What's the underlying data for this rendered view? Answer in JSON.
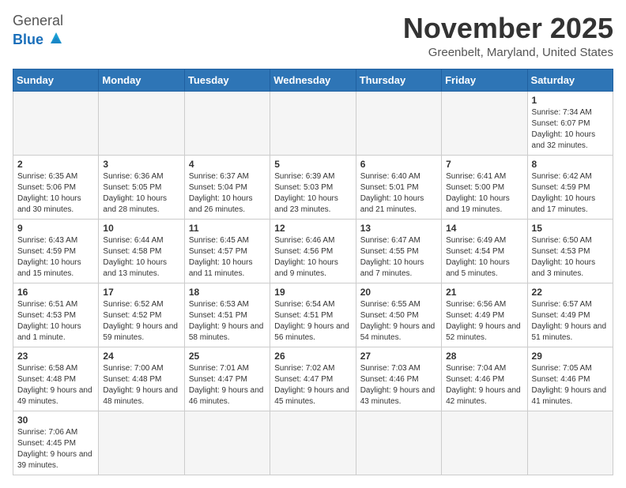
{
  "header": {
    "logo_general": "General",
    "logo_blue": "Blue",
    "month_title": "November 2025",
    "location": "Greenbelt, Maryland, United States"
  },
  "weekdays": [
    "Sunday",
    "Monday",
    "Tuesday",
    "Wednesday",
    "Thursday",
    "Friday",
    "Saturday"
  ],
  "weeks": [
    [
      {
        "day": "",
        "info": ""
      },
      {
        "day": "",
        "info": ""
      },
      {
        "day": "",
        "info": ""
      },
      {
        "day": "",
        "info": ""
      },
      {
        "day": "",
        "info": ""
      },
      {
        "day": "",
        "info": ""
      },
      {
        "day": "1",
        "info": "Sunrise: 7:34 AM\nSunset: 6:07 PM\nDaylight: 10 hours and 32 minutes."
      }
    ],
    [
      {
        "day": "2",
        "info": "Sunrise: 6:35 AM\nSunset: 5:06 PM\nDaylight: 10 hours and 30 minutes."
      },
      {
        "day": "3",
        "info": "Sunrise: 6:36 AM\nSunset: 5:05 PM\nDaylight: 10 hours and 28 minutes."
      },
      {
        "day": "4",
        "info": "Sunrise: 6:37 AM\nSunset: 5:04 PM\nDaylight: 10 hours and 26 minutes."
      },
      {
        "day": "5",
        "info": "Sunrise: 6:39 AM\nSunset: 5:03 PM\nDaylight: 10 hours and 23 minutes."
      },
      {
        "day": "6",
        "info": "Sunrise: 6:40 AM\nSunset: 5:01 PM\nDaylight: 10 hours and 21 minutes."
      },
      {
        "day": "7",
        "info": "Sunrise: 6:41 AM\nSunset: 5:00 PM\nDaylight: 10 hours and 19 minutes."
      },
      {
        "day": "8",
        "info": "Sunrise: 6:42 AM\nSunset: 4:59 PM\nDaylight: 10 hours and 17 minutes."
      }
    ],
    [
      {
        "day": "9",
        "info": "Sunrise: 6:43 AM\nSunset: 4:59 PM\nDaylight: 10 hours and 15 minutes."
      },
      {
        "day": "10",
        "info": "Sunrise: 6:44 AM\nSunset: 4:58 PM\nDaylight: 10 hours and 13 minutes."
      },
      {
        "day": "11",
        "info": "Sunrise: 6:45 AM\nSunset: 4:57 PM\nDaylight: 10 hours and 11 minutes."
      },
      {
        "day": "12",
        "info": "Sunrise: 6:46 AM\nSunset: 4:56 PM\nDaylight: 10 hours and 9 minutes."
      },
      {
        "day": "13",
        "info": "Sunrise: 6:47 AM\nSunset: 4:55 PM\nDaylight: 10 hours and 7 minutes."
      },
      {
        "day": "14",
        "info": "Sunrise: 6:49 AM\nSunset: 4:54 PM\nDaylight: 10 hours and 5 minutes."
      },
      {
        "day": "15",
        "info": "Sunrise: 6:50 AM\nSunset: 4:53 PM\nDaylight: 10 hours and 3 minutes."
      }
    ],
    [
      {
        "day": "16",
        "info": "Sunrise: 6:51 AM\nSunset: 4:53 PM\nDaylight: 10 hours and 1 minute."
      },
      {
        "day": "17",
        "info": "Sunrise: 6:52 AM\nSunset: 4:52 PM\nDaylight: 9 hours and 59 minutes."
      },
      {
        "day": "18",
        "info": "Sunrise: 6:53 AM\nSunset: 4:51 PM\nDaylight: 9 hours and 58 minutes."
      },
      {
        "day": "19",
        "info": "Sunrise: 6:54 AM\nSunset: 4:51 PM\nDaylight: 9 hours and 56 minutes."
      },
      {
        "day": "20",
        "info": "Sunrise: 6:55 AM\nSunset: 4:50 PM\nDaylight: 9 hours and 54 minutes."
      },
      {
        "day": "21",
        "info": "Sunrise: 6:56 AM\nSunset: 4:49 PM\nDaylight: 9 hours and 52 minutes."
      },
      {
        "day": "22",
        "info": "Sunrise: 6:57 AM\nSunset: 4:49 PM\nDaylight: 9 hours and 51 minutes."
      }
    ],
    [
      {
        "day": "23",
        "info": "Sunrise: 6:58 AM\nSunset: 4:48 PM\nDaylight: 9 hours and 49 minutes."
      },
      {
        "day": "24",
        "info": "Sunrise: 7:00 AM\nSunset: 4:48 PM\nDaylight: 9 hours and 48 minutes."
      },
      {
        "day": "25",
        "info": "Sunrise: 7:01 AM\nSunset: 4:47 PM\nDaylight: 9 hours and 46 minutes."
      },
      {
        "day": "26",
        "info": "Sunrise: 7:02 AM\nSunset: 4:47 PM\nDaylight: 9 hours and 45 minutes."
      },
      {
        "day": "27",
        "info": "Sunrise: 7:03 AM\nSunset: 4:46 PM\nDaylight: 9 hours and 43 minutes."
      },
      {
        "day": "28",
        "info": "Sunrise: 7:04 AM\nSunset: 4:46 PM\nDaylight: 9 hours and 42 minutes."
      },
      {
        "day": "29",
        "info": "Sunrise: 7:05 AM\nSunset: 4:46 PM\nDaylight: 9 hours and 41 minutes."
      }
    ],
    [
      {
        "day": "30",
        "info": "Sunrise: 7:06 AM\nSunset: 4:45 PM\nDaylight: 9 hours and 39 minutes."
      },
      {
        "day": "",
        "info": ""
      },
      {
        "day": "",
        "info": ""
      },
      {
        "day": "",
        "info": ""
      },
      {
        "day": "",
        "info": ""
      },
      {
        "day": "",
        "info": ""
      },
      {
        "day": "",
        "info": ""
      }
    ]
  ]
}
